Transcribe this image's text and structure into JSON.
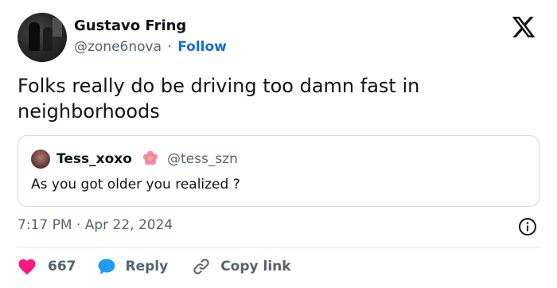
{
  "author": {
    "name": "Gustavo Fring",
    "handle": "@zone6nova",
    "separator": "·",
    "follow_label": "Follow"
  },
  "tweet": {
    "text": "Folks really do be driving too damn fast in neighborhoods"
  },
  "quoted": {
    "name": "Tess_xoxo",
    "handle": "@tess_szn",
    "text": "As you got older you realized ?"
  },
  "timestamp": "7:17 PM · Apr 22, 2024",
  "actions": {
    "like_count": "667",
    "reply_label": "Reply",
    "copy_label": "Copy link"
  },
  "colors": {
    "accent_blue": "#0f6fd8",
    "like_pink": "#f91880",
    "reply_blue": "#1d9bf0",
    "muted_text": "#536471"
  },
  "icons": [
    "x-logo-icon",
    "flower-emoji-icon",
    "info-icon",
    "heart-icon",
    "reply-bubble-icon",
    "link-icon"
  ]
}
